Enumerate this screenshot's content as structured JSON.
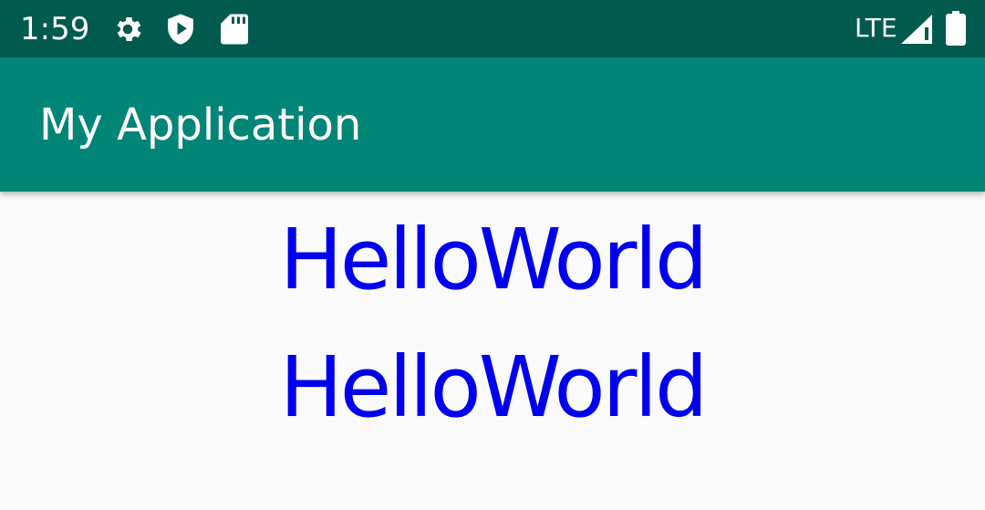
{
  "status_bar": {
    "time": "1:59",
    "network": "LTE",
    "icons": [
      "gear-icon",
      "play-protect-icon",
      "sd-card-icon",
      "signal-icon",
      "battery-icon"
    ],
    "background_color": "#005a4e"
  },
  "app_bar": {
    "title": "My Application",
    "background_color": "#008577"
  },
  "content": {
    "texts": [
      "HelloWorld",
      "HelloWorld"
    ],
    "text_color": "#0000ee"
  }
}
